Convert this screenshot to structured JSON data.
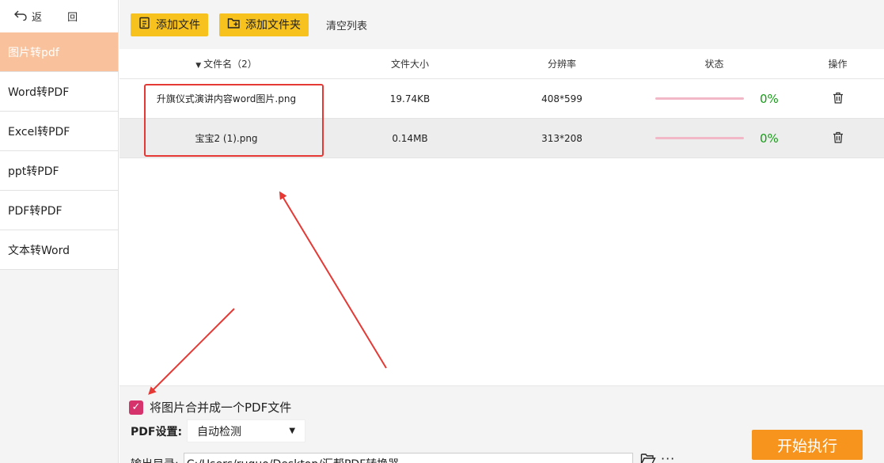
{
  "sidebar": {
    "back_label": "返 回",
    "items": [
      {
        "label": "图片转pdf",
        "active": true
      },
      {
        "label": "Word转PDF",
        "active": false
      },
      {
        "label": "Excel转PDF",
        "active": false
      },
      {
        "label": "ppt转PDF",
        "active": false
      },
      {
        "label": "PDF转PDF",
        "active": false
      },
      {
        "label": "文本转Word",
        "active": false
      }
    ]
  },
  "toolbar": {
    "add_file": "添加文件",
    "add_folder": "添加文件夹",
    "clear_list": "清空列表"
  },
  "table": {
    "headers": {
      "name": "文件名（2）",
      "size": "文件大小",
      "resolution": "分辨率",
      "status": "状态",
      "operation": "操作"
    },
    "rows": [
      {
        "name": "升旗仪式演讲内容word图片.png",
        "size": "19.74KB",
        "resolution": "408*599",
        "percent": "0%"
      },
      {
        "name": "宝宝2 (1).png",
        "size": "0.14MB",
        "resolution": "313*208",
        "percent": "0%"
      }
    ]
  },
  "bottom": {
    "merge_label": "将图片合并成一个PDF文件",
    "merge_checked": true,
    "pdf_settings_label": "PDF设置:",
    "pdf_settings_value": "自动检测",
    "output_dir_label": "输出目录:",
    "output_dir_value": "C:/Users/ruguo/Desktop/汇帮PDF转换器",
    "more_label": "···",
    "start_button": "开始执行"
  },
  "colors": {
    "accent": "#f7c21e",
    "active_nav": "#f9c29c",
    "start": "#f7941d",
    "percent": "#1a9a1a",
    "progress": "#f2b8c8",
    "annotation": "#e53935",
    "checkbox": "#d6336c"
  },
  "icons": {
    "back": "back-arrow-icon",
    "add_file": "file-icon",
    "add_folder": "folder-plus-icon",
    "delete": "trash-icon",
    "browse": "folder-open-icon"
  }
}
